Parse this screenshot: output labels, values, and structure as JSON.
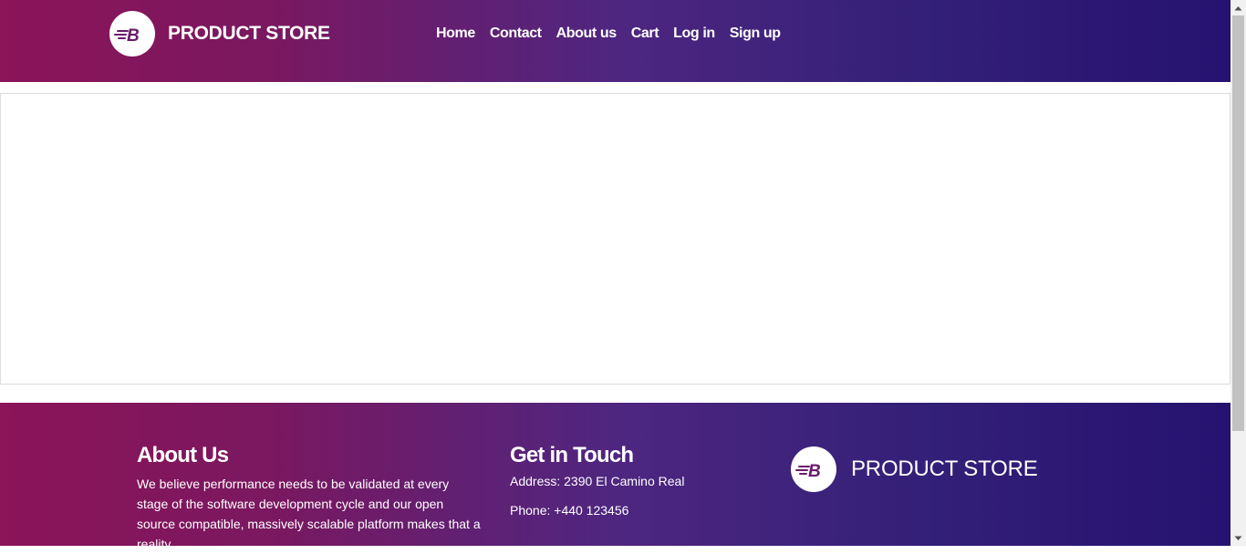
{
  "navbar": {
    "brand": "PRODUCT STORE",
    "logo_icon": "blazedemo-b-logo-icon",
    "links": [
      "Home",
      "Contact",
      "About us",
      "Cart",
      "Log in",
      "Sign up"
    ]
  },
  "carousel": {},
  "footer": {
    "about": {
      "title": "About Us",
      "text": "We believe performance needs to be validated at every stage of the software development cycle and our open source compatible, massively scalable platform makes that a reality."
    },
    "contact": {
      "title": "Get in Touch",
      "address": "Address: 2390 El Camino Real",
      "phone": "Phone: +440 123456"
    },
    "brand": "PRODUCT STORE",
    "logo_icon": "blazedemo-b-logo-icon"
  },
  "colors": {
    "gradient_start": "#8c1458",
    "gradient_end": "#261270",
    "logo_accent": "#6a1b6e",
    "text": "#ffffff"
  }
}
